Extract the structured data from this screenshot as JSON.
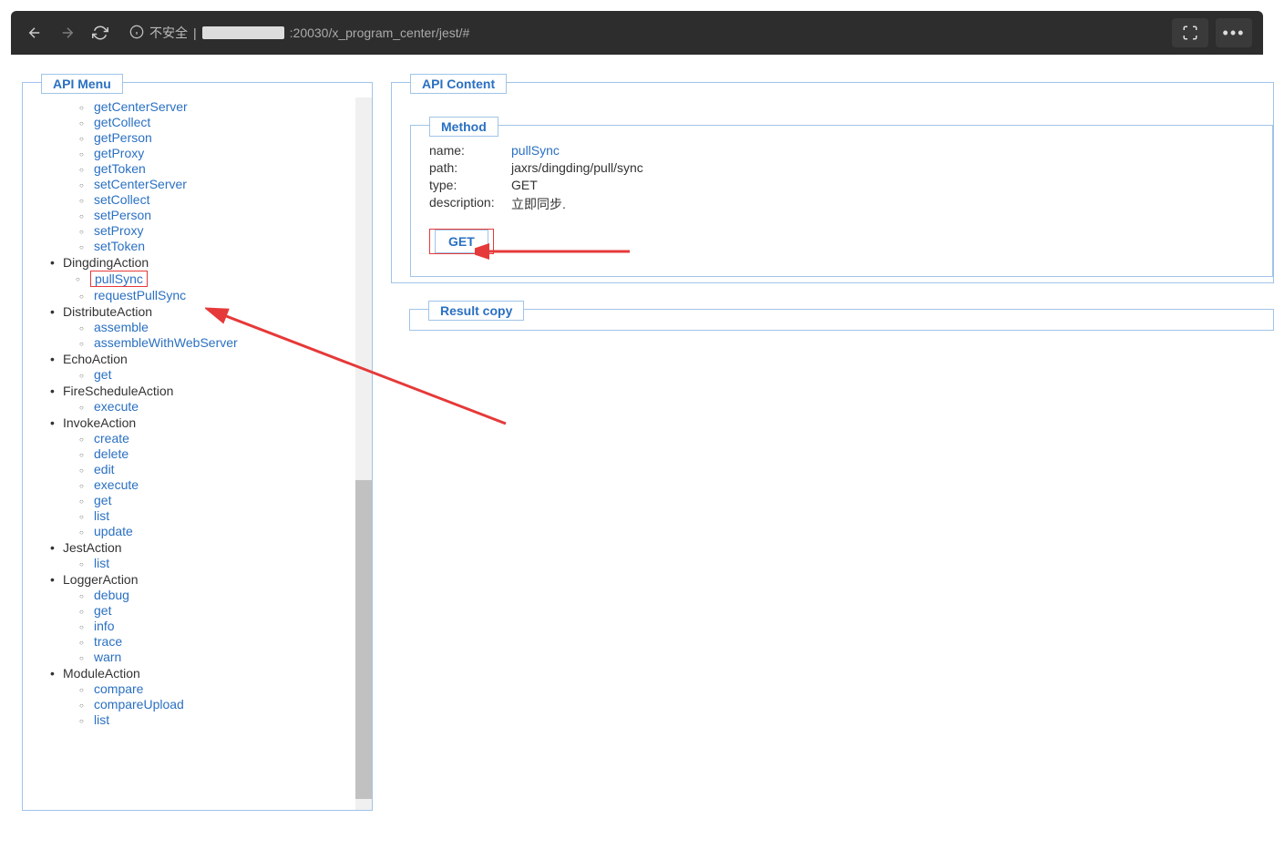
{
  "browser": {
    "insecure_label": "不安全",
    "url_prefix": "|",
    "url_port": ":20030/x_program_center/jest/#"
  },
  "left": {
    "title": "API Menu",
    "orphan_items": [
      "getCenterServer",
      "getCollect",
      "getPerson",
      "getProxy",
      "getToken",
      "setCenterServer",
      "setCollect",
      "setPerson",
      "setProxy",
      "setToken"
    ],
    "groups": [
      {
        "name": "DingdingAction",
        "items": [
          "pullSync",
          "requestPullSync"
        ],
        "highlight": "pullSync"
      },
      {
        "name": "DistributeAction",
        "items": [
          "assemble",
          "assembleWithWebServer"
        ]
      },
      {
        "name": "EchoAction",
        "items": [
          "get"
        ]
      },
      {
        "name": "FireScheduleAction",
        "items": [
          "execute"
        ]
      },
      {
        "name": "InvokeAction",
        "items": [
          "create",
          "delete",
          "edit",
          "execute",
          "get",
          "list",
          "update"
        ]
      },
      {
        "name": "JestAction",
        "items": [
          "list"
        ]
      },
      {
        "name": "LoggerAction",
        "items": [
          "debug",
          "get",
          "info",
          "trace",
          "warn"
        ]
      },
      {
        "name": "ModuleAction",
        "items": [
          "compare",
          "compareUpload",
          "list"
        ]
      }
    ]
  },
  "right": {
    "content_title": "API Content",
    "method_title": "Method",
    "result_title": "Result copy",
    "method": {
      "name_label": "name:",
      "name_value": "pullSync",
      "path_label": "path:",
      "path_value": "jaxrs/dingding/pull/sync",
      "type_label": "type:",
      "type_value": "GET",
      "desc_label": "description:",
      "desc_value": "立即同步.",
      "button": "GET"
    }
  }
}
